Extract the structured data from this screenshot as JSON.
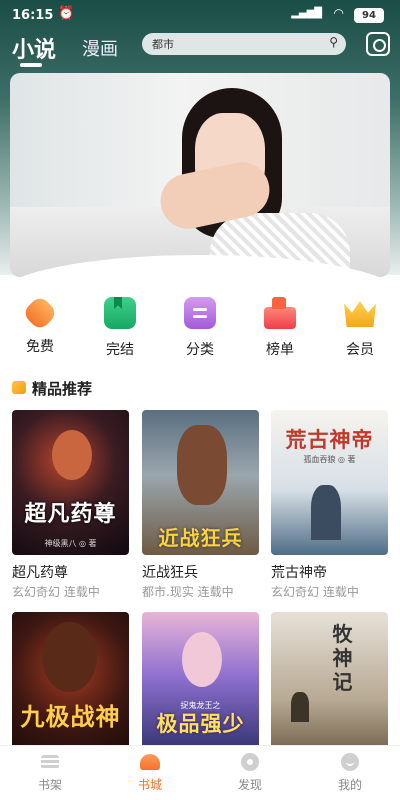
{
  "status_bar": {
    "time": "16:15",
    "battery": "94"
  },
  "header": {
    "tab_novel": "小说",
    "tab_comic": "漫画",
    "search_placeholder": "都市"
  },
  "categories": [
    {
      "label": "免费",
      "icon": "free-icon"
    },
    {
      "label": "完结",
      "icon": "completed-book-icon"
    },
    {
      "label": "分类",
      "icon": "category-icon"
    },
    {
      "label": "榜单",
      "icon": "ranking-icon"
    },
    {
      "label": "会员",
      "icon": "vip-crown-icon"
    }
  ],
  "section": {
    "title": "精品推荐"
  },
  "books": [
    {
      "name": "超凡药尊",
      "meta": "玄幻奇幻 连载中",
      "cover_title": "超凡药尊",
      "cover_author": "神级黑八 ◎ 著"
    },
    {
      "name": "近战狂兵",
      "meta": "都市.现实 连载中",
      "cover_title": "近战狂兵"
    },
    {
      "name": "荒古神帝",
      "meta": "玄幻奇幻 连载中",
      "cover_title": "荒古神帝",
      "cover_author": "孤血吞狼 ◎ 著"
    },
    {
      "name": "",
      "meta": "",
      "cover_title": "九极战神"
    },
    {
      "name": "",
      "meta": "",
      "cover_title": "极品强少",
      "cover_subtitle": "捉鬼龙王之"
    },
    {
      "name": "",
      "meta": "",
      "cover_title": "牧神记"
    }
  ],
  "tabbar": [
    {
      "label": "书架"
    },
    {
      "label": "书城"
    },
    {
      "label": "发现"
    },
    {
      "label": "我的"
    }
  ]
}
